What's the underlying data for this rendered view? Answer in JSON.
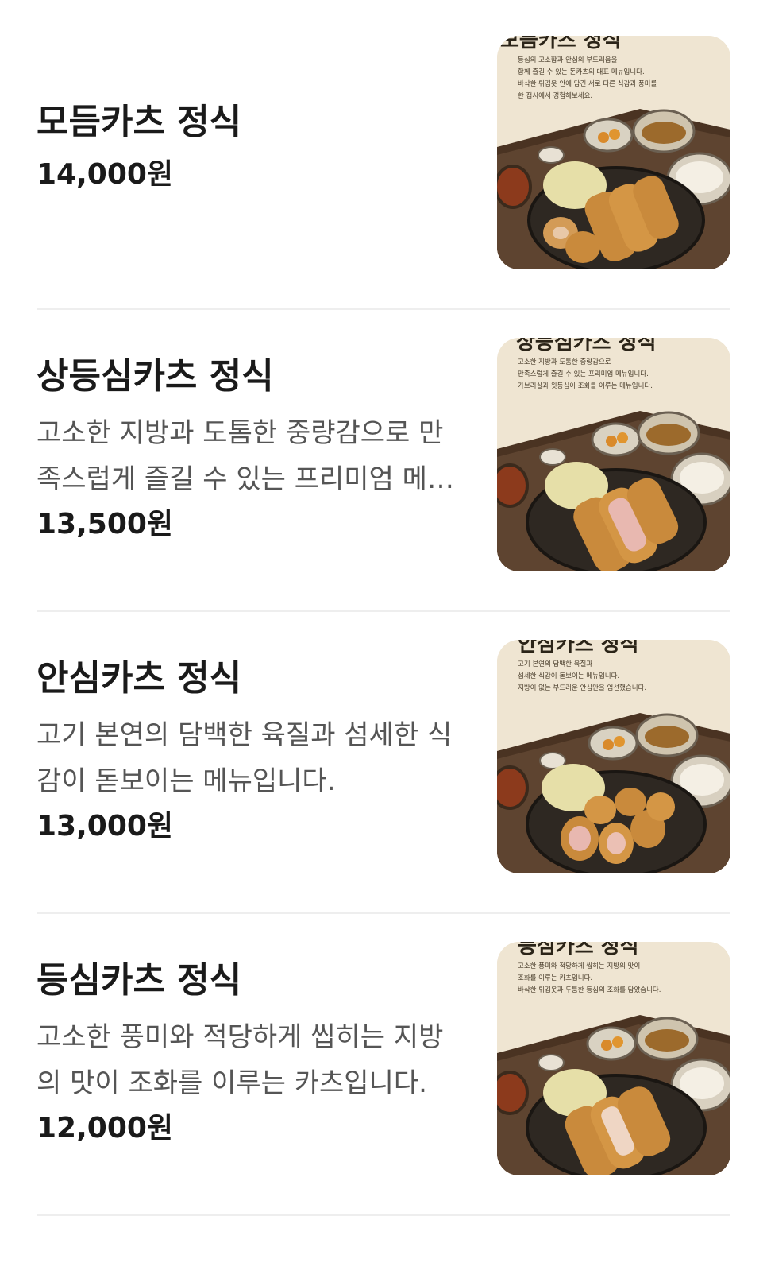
{
  "menu_items": [
    {
      "name": "모듬카츠 정식",
      "description": "",
      "price": "14,000원",
      "photo": {
        "title": "모듬카츠 정식",
        "caption_lines": [
          "등심의 고소함과 안심의 부드러움을",
          "함께 즐길 수 있는 돈카츠의 대표 메뉴입니다.",
          "바삭한 튀김옷 안에 담긴 서로 다른 식감과 풍미를",
          "한 접시에서 경험해보세요."
        ]
      }
    },
    {
      "name": "상등심카츠 정식",
      "description": "고소한 지방과 도톰한 중량감으로 만족스럽게 즐길 수 있는 프리미엄 메뉴입니다.",
      "price": "13,500원",
      "photo": {
        "title": "상등심카츠 정식",
        "caption_lines": [
          "고소한 지방과 도톰한 중량감으로",
          "만족스럽게 즐길 수 있는 프리미엄 메뉴입니다.",
          "가브리살과 윗등심이 조화를 이루는 메뉴입니다."
        ]
      }
    },
    {
      "name": "안심카츠 정식",
      "description": "고기 본연의 담백한 육질과 섬세한 식감이 돋보이는 메뉴입니다.",
      "price": "13,000원",
      "photo": {
        "title": "안심카츠 정식",
        "caption_lines": [
          "고기 본연의 담백한 육질과",
          "섬세한 식감이 돋보이는 메뉴입니다.",
          "지방이 없는 부드러운 안심만을 엄선했습니다."
        ]
      }
    },
    {
      "name": "등심카츠 정식",
      "description": "고소한 풍미와 적당하게 씹히는 지방의 맛이 조화를 이루는 카츠입니다.",
      "price": "12,000원",
      "photo": {
        "title": "등심카츠 정식",
        "caption_lines": [
          "고소한 풍미와 적당하게 씹히는 지방의 맛이",
          "조화를 이루는 카츠입니다.",
          "바삭한 튀김옷과 두툼한 등심의 조화를 담았습니다."
        ]
      }
    }
  ]
}
